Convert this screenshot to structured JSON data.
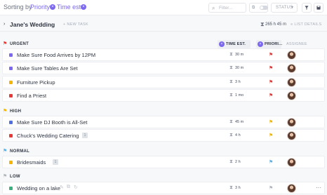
{
  "toolbar": {
    "sort_label": "Sorting by",
    "sort_chips": [
      "Priority",
      "Time est."
    ],
    "filter_placeholder": "Filter...",
    "status_label": "STATUS",
    "filter_icon": "funnel-icon",
    "save_icon": "floppy-icon"
  },
  "list": {
    "title": "Jane's Wedding",
    "more": "···",
    "new_task": "+ NEW TASK",
    "time_total": "265 h 45 m",
    "details": "≡ LIST DETAILS"
  },
  "columns": {
    "time": "TIME EST.",
    "priority": "PRIORI...",
    "assignee": "ASSIGNEE"
  },
  "colors": {
    "accent": "#7b68ee",
    "urgent": "#e53935",
    "high": "#f5b400",
    "normal": "#5fb0e6",
    "low": "#b0b5bd"
  },
  "groups": [
    {
      "name": "URGENT",
      "color": "#e53935",
      "tasks": [
        {
          "name": "Make Sure Food Arrives by 12PM",
          "status_color": "#7b68ee",
          "time": "30 m",
          "priority_color": "#e53935"
        },
        {
          "name": "Make Sure Tables Are Set",
          "status_color": "#7b68ee",
          "time": "30 m",
          "priority_color": "#e53935"
        },
        {
          "name": "Furniture Pickup",
          "status_color": "#f5b400",
          "time": "3 h",
          "priority_color": "#e53935"
        },
        {
          "name": "Find a Priest",
          "status_color": "#e53935",
          "time": "1 mo",
          "priority_color": "#e53935"
        }
      ]
    },
    {
      "name": "HIGH",
      "color": "#f5b400",
      "tasks": [
        {
          "name": "Make Sure DJ Booth is All-Set",
          "status_color": "#4d6fe0",
          "time": "45 m",
          "priority_color": "#f5b400"
        },
        {
          "name": "Chuck's Wedding Catering",
          "status_color": "#e53935",
          "time": "4 h",
          "priority_color": "#f5b400",
          "tag": "1"
        }
      ]
    },
    {
      "name": "NORMAL",
      "color": "#5fb0e6",
      "tasks": [
        {
          "name": "Bridesmaids",
          "status_color": "#f5b400",
          "time": "2 h",
          "priority_color": "#5fb0e6",
          "tag": "1"
        }
      ]
    },
    {
      "name": "LOW",
      "color": "#b0b5bd",
      "tasks": [
        {
          "name": "Wedding on a lake",
          "status_color": "#3bb07d",
          "time": "3 h",
          "priority_color": "#b0b5bd",
          "row_more": "···"
        }
      ]
    }
  ]
}
